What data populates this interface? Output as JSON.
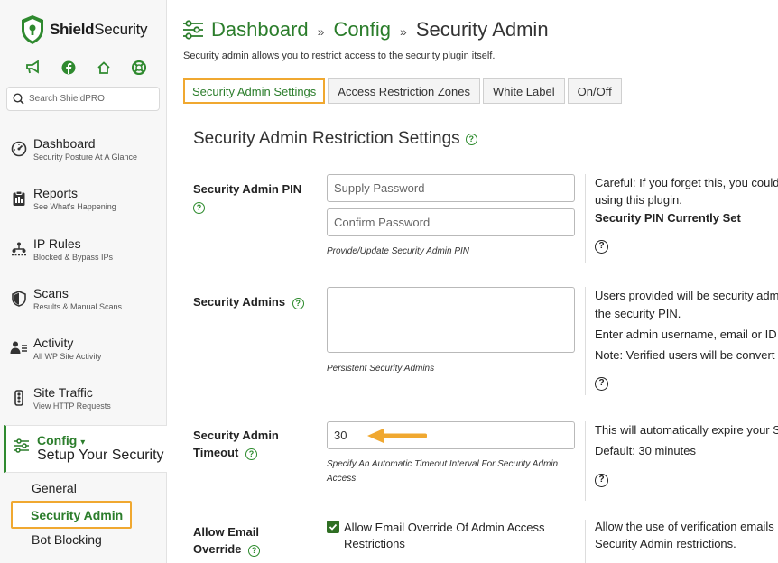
{
  "brand": {
    "name_bold": "Shield",
    "name_rest": "Security"
  },
  "search": {
    "placeholder": "Search ShieldPRO"
  },
  "nav": [
    {
      "title": "Dashboard",
      "subtitle": "Security Posture At A Glance",
      "icon": "dashboard-gauge-icon"
    },
    {
      "title": "Reports",
      "subtitle": "See What's Happening",
      "icon": "reports-clipboard-icon"
    },
    {
      "title": "IP Rules",
      "subtitle": "Blocked & Bypass IPs",
      "icon": "ip-network-icon"
    },
    {
      "title": "Scans",
      "subtitle": "Results & Manual Scans",
      "icon": "shield-scan-icon"
    },
    {
      "title": "Activity",
      "subtitle": "All WP Site Activity",
      "icon": "user-activity-icon"
    },
    {
      "title": "Site Traffic",
      "subtitle": "View HTTP Requests",
      "icon": "traffic-icon"
    },
    {
      "title": "Config",
      "subtitle": "Setup Your Security",
      "icon": "sliders-icon",
      "caret": "▾"
    }
  ],
  "config_sub": {
    "general": "General",
    "security_admin": "Security Admin",
    "bot_blocking": "Bot Blocking"
  },
  "header": {
    "crumb1": "Dashboard",
    "crumb2": "Config",
    "sep": "»",
    "current": "Security Admin",
    "description": "Security admin allows you to restrict access to the security plugin itself."
  },
  "tabs": [
    "Security Admin Settings",
    "Access Restriction Zones",
    "White Label",
    "On/Off"
  ],
  "section": {
    "title": "Security Admin Restriction Settings"
  },
  "pin": {
    "label": "Security Admin PIN",
    "placeholder1": "Supply Password",
    "placeholder2": "Confirm Password",
    "hint": "Provide/Update Security Admin PIN",
    "info1": "Careful: If you forget this, you could",
    "info2": "using this plugin.",
    "info_bold": "Security PIN Currently Set"
  },
  "admins": {
    "label": "Security Admins",
    "hint": "Persistent Security Admins",
    "info1": "Users provided will be security adm",
    "info2": "the security PIN.",
    "info3": "Enter admin username, email or ID",
    "info4": "Note: Verified users will be convert"
  },
  "timeout": {
    "label1": "Security Admin",
    "label2": "Timeout",
    "value": "30",
    "hint1": "Specify An Automatic Timeout Interval For Security Admin",
    "hint2": "Access",
    "info1": "This will automatically expire your S",
    "info2": "Default: 30 minutes"
  },
  "email": {
    "label1": "Allow Email",
    "label2": "Override",
    "checkbox_label": "Allow Email Override Of Admin Access Restrictions",
    "checked": true,
    "info1": "Allow the use of verification emails",
    "info2": "Security Admin restrictions."
  },
  "colors": {
    "accent_green": "#2b7d2b",
    "highlight_orange": "#f0a830"
  }
}
